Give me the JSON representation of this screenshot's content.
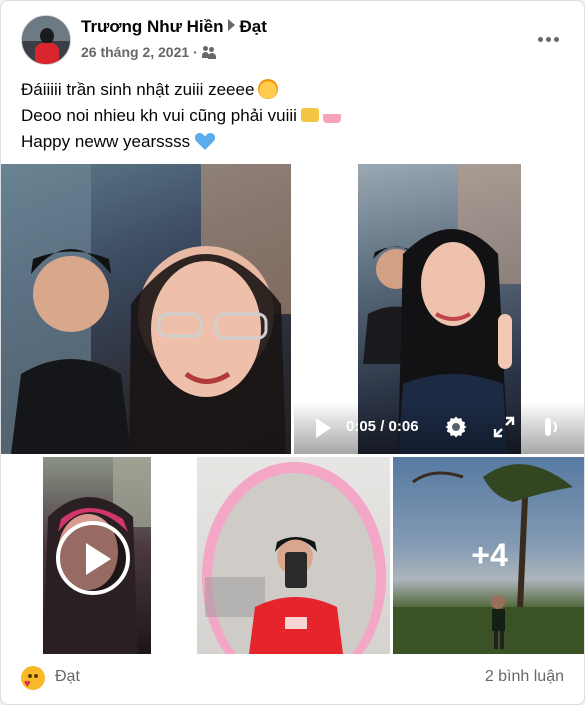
{
  "post": {
    "author": "Trương Như Hiền",
    "recipient": "Đạt",
    "date": "26 tháng 2, 2021",
    "dot": "·",
    "audience_icon": "friends-icon",
    "more_icon": "more-horizontal-icon",
    "lines": [
      "Đáiiiii trần sinh nhật zuiii zeeee",
      "Deoo noi nhieu kh vui cũng phải vuiii",
      "Happy neww yearssss"
    ],
    "line_emojis": [
      "partying-face-emoji",
      "crown-and-cake-emoji",
      "blue-heart-emoji"
    ]
  },
  "media": {
    "video_time": "0:05 / 0:06",
    "extra_count": "+4"
  },
  "footer": {
    "reaction_icon": "care-reaction-icon",
    "reaction_name": "Đạt",
    "comments": "2 bình luận"
  },
  "colors": {
    "secondary_text": "#65676b",
    "primary_text": "#050505",
    "card_border": "#dadde1",
    "care_yellow": "#f7b928"
  }
}
